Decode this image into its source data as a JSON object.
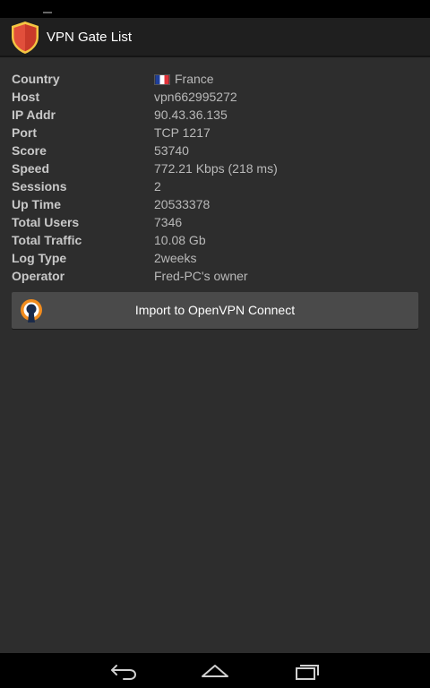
{
  "app": {
    "title": "VPN Gate List",
    "icon": "shield-icon",
    "accent_color": "#e85a3c"
  },
  "details": [
    {
      "key": "country",
      "label": "Country",
      "value": "France",
      "flag": "france-flag-icon"
    },
    {
      "key": "host",
      "label": "Host",
      "value": "vpn662995272"
    },
    {
      "key": "ip",
      "label": "IP Addr",
      "value": "90.43.36.135"
    },
    {
      "key": "port",
      "label": "Port",
      "value": "TCP 1217"
    },
    {
      "key": "score",
      "label": "Score",
      "value": "53740"
    },
    {
      "key": "speed",
      "label": "Speed",
      "value": "772.21 Kbps (218 ms)"
    },
    {
      "key": "sessions",
      "label": "Sessions",
      "value": "2"
    },
    {
      "key": "uptime",
      "label": "Up Time",
      "value": "20533378"
    },
    {
      "key": "total-users",
      "label": "Total Users",
      "value": "7346"
    },
    {
      "key": "total-traffic",
      "label": "Total Traffic",
      "value": "10.08 Gb"
    },
    {
      "key": "log-type",
      "label": "Log Type",
      "value": "2weeks"
    },
    {
      "key": "operator",
      "label": "Operator",
      "value": "Fred-PC's owner"
    }
  ],
  "import_button": {
    "label": "Import to OpenVPN Connect",
    "icon": "openvpn-icon"
  },
  "nav": {
    "back_icon": "back-icon",
    "home_icon": "home-icon",
    "recents_icon": "recents-icon"
  }
}
